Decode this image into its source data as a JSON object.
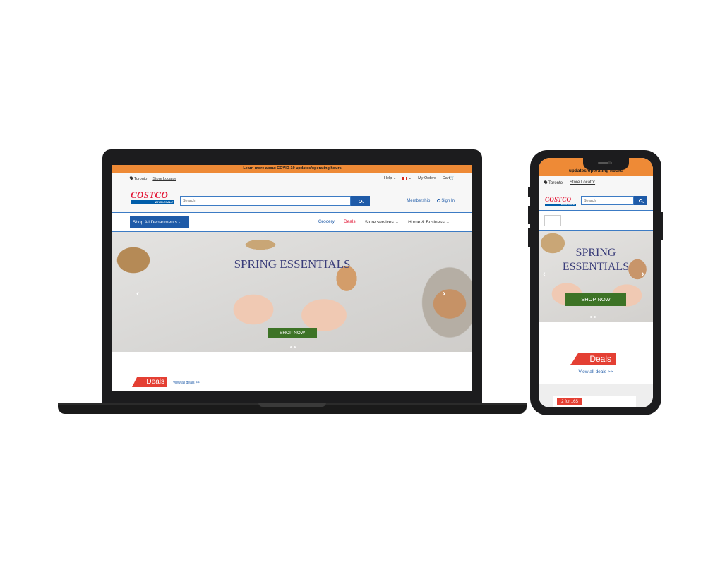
{
  "desktop": {
    "covid_banner": "Learn more about COVID-19 updates/operating hours",
    "utility": {
      "location": "Toronto",
      "store_locator": "Store Locator",
      "help": "Help",
      "my_orders": "My Orders",
      "cart": "Cart"
    },
    "logo": {
      "main": "COSTCO",
      "sub": "WHOLESALE"
    },
    "search": {
      "placeholder": "Search"
    },
    "header_links": {
      "membership": "Membership",
      "sign_in": "Sign In"
    },
    "nav": {
      "shop_all": "Shop All Departments",
      "links": [
        "Grocery",
        "Deals",
        "Store services",
        "Home & Business"
      ]
    },
    "hero": {
      "title": "SPRING ESSENTIALS",
      "cta": "SHOP NOW"
    },
    "deals": {
      "badge": "Deals",
      "view_all": "View all deals >>"
    }
  },
  "mobile": {
    "covid_banner": "updates/operating hours",
    "utility": {
      "location": "Toronto",
      "store_locator": "Store Locator"
    },
    "search": {
      "placeholder": "Search"
    },
    "hero": {
      "title_line1": "SPRING",
      "title_line2": "ESSENTIALS",
      "cta": "SHOP NOW"
    },
    "deals": {
      "badge": "Deals",
      "view_all": "View all deals >>"
    },
    "promo": "2 for 16$"
  },
  "colors": {
    "banner_orange": "#ee8a36",
    "brand_blue": "#1f5ba8",
    "brand_red": "#e31837",
    "cta_green": "#3d7326",
    "deals_red": "#e43f33"
  },
  "icons": [
    "location-pin-icon",
    "chevron-down-icon",
    "canada-flag-icon",
    "cart-icon",
    "search-icon",
    "user-icon",
    "hamburger-menu-icon",
    "arrow-left-icon",
    "arrow-right-icon"
  ]
}
